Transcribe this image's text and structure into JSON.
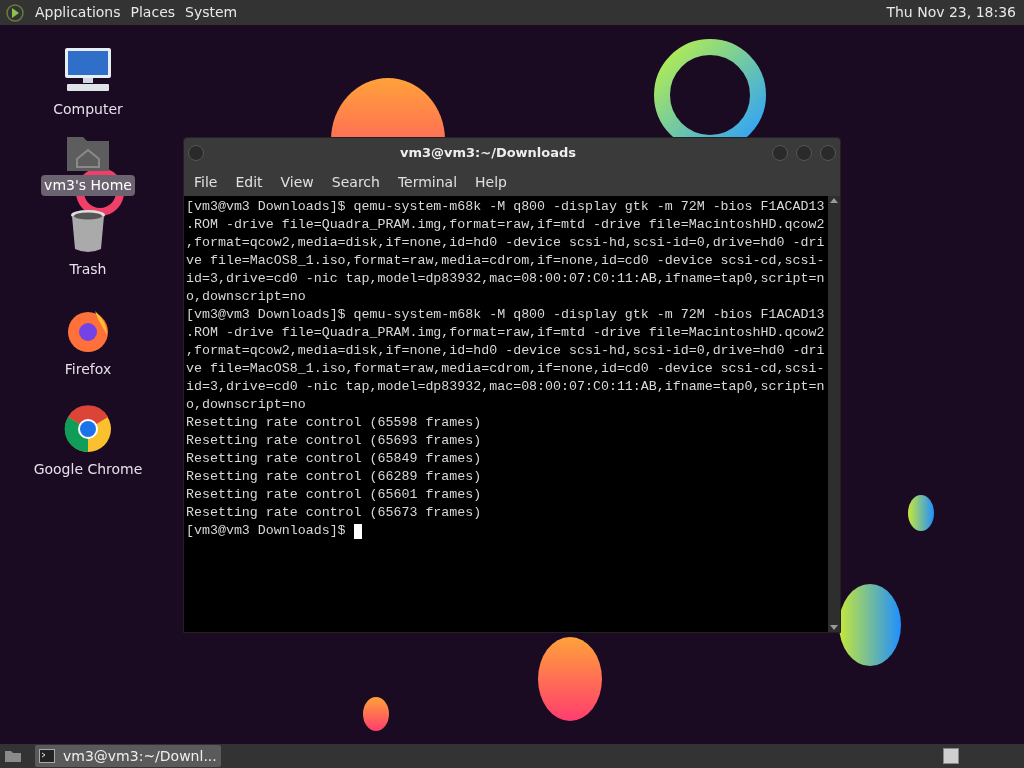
{
  "top_panel": {
    "menus": [
      "Applications",
      "Places",
      "System"
    ],
    "clock": "Thu Nov 23, 18:36"
  },
  "desktop_icons": [
    {
      "kind": "computer",
      "label": "Computer",
      "selected": false
    },
    {
      "kind": "home",
      "label": "vm3's Home",
      "selected": true
    },
    {
      "kind": "trash",
      "label": "Trash",
      "selected": false
    },
    {
      "kind": "firefox",
      "label": "Firefox",
      "selected": false
    },
    {
      "kind": "chrome",
      "label": "Google Chrome",
      "selected": false
    }
  ],
  "terminal": {
    "title": "vm3@vm3:~/Downloads",
    "menu": [
      "File",
      "Edit",
      "View",
      "Search",
      "Terminal",
      "Help"
    ],
    "lines": [
      "[vm3@vm3 Downloads]$ qemu-system-m68k -M q800 -display gtk -m 72M -bios F1ACAD13",
      ".ROM -drive file=Quadra_PRAM.img,format=raw,if=mtd -drive file=MacintoshHD.qcow2",
      ",format=qcow2,media=disk,if=none,id=hd0 -device scsi-hd,scsi-id=0,drive=hd0 -dri",
      "ve file=MacOS8_1.iso,format=raw,media=cdrom,if=none,id=cd0 -device scsi-cd,scsi-",
      "id=3,drive=cd0 -nic tap,model=dp83932,mac=08:00:07:C0:11:AB,ifname=tap0,script=n",
      "o,downscript=no",
      "[vm3@vm3 Downloads]$ qemu-system-m68k -M q800 -display gtk -m 72M -bios F1ACAD13",
      ".ROM -drive file=Quadra_PRAM.img,format=raw,if=mtd -drive file=MacintoshHD.qcow2",
      ",format=qcow2,media=disk,if=none,id=hd0 -device scsi-hd,scsi-id=0,drive=hd0 -dri",
      "ve file=MacOS8_1.iso,format=raw,media=cdrom,if=none,id=cd0 -device scsi-cd,scsi-",
      "id=3,drive=cd0 -nic tap,model=dp83932,mac=08:00:07:C0:11:AB,ifname=tap0,script=n",
      "o,downscript=no",
      "Resetting rate control (65598 frames)",
      "Resetting rate control (65693 frames)",
      "Resetting rate control (65849 frames)",
      "Resetting rate control (66289 frames)",
      "Resetting rate control (65601 frames)",
      "Resetting rate control (65673 frames)"
    ],
    "prompt": "[vm3@vm3 Downloads]$"
  },
  "taskbar": {
    "tasks": [
      {
        "label": "vm3@vm3:~/Downl...",
        "selected": true
      }
    ]
  }
}
